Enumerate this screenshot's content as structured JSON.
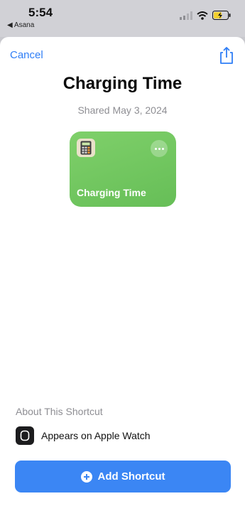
{
  "status_bar": {
    "time": "5:54",
    "back_app": "◀ Asana"
  },
  "header": {
    "cancel_label": "Cancel",
    "share_icon": "share-icon"
  },
  "shortcut": {
    "title": "Charging Time",
    "shared_text": "Shared May 3, 2024",
    "card_label": "Charging Time",
    "card_color": "#6cc35c",
    "card_icon": "calculator-icon"
  },
  "about": {
    "header": "About This Shortcut",
    "items": [
      {
        "label": "Appears on Apple Watch",
        "icon": "apple-watch-icon"
      }
    ]
  },
  "actions": {
    "add_label": "Add Shortcut",
    "accent": "#3b86f4"
  }
}
